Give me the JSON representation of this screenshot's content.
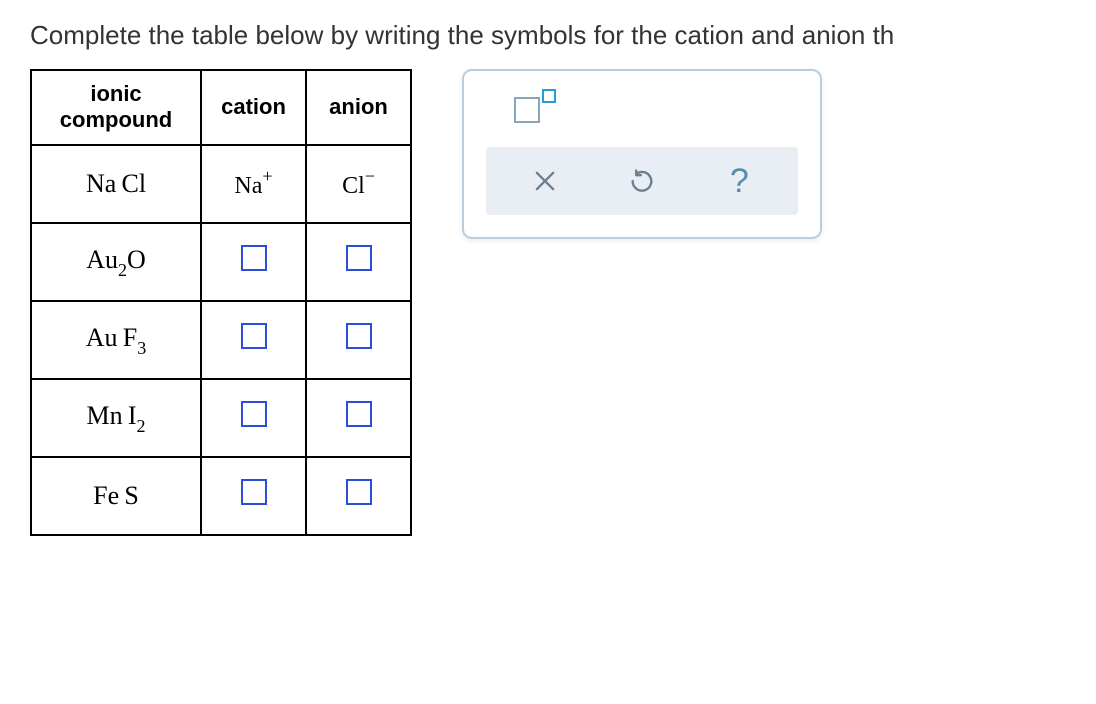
{
  "instruction": "Complete the table below by writing the symbols for the cation and anion th",
  "table": {
    "headers": {
      "compound_line1": "ionic",
      "compound_line2": "compound",
      "cation": "cation",
      "anion": "anion"
    },
    "rows": [
      {
        "compound_base1": "Na",
        "compound_sub1": "",
        "compound_base2": "Cl",
        "compound_sub2": "",
        "cation_base": "Na",
        "cation_sup": "+",
        "anion_base": "Cl",
        "anion_sup": "−",
        "filled": true
      },
      {
        "compound_base1": "Au",
        "compound_sub1": "2",
        "compound_base2": "O",
        "compound_sub2": "",
        "filled": false
      },
      {
        "compound_base1": "Au",
        "compound_sub1": "",
        "compound_base2": "F",
        "compound_sub2": "3",
        "filled": false
      },
      {
        "compound_base1": "Mn",
        "compound_sub1": "",
        "compound_base2": "I",
        "compound_sub2": "2",
        "filled": false
      },
      {
        "compound_base1": "Fe",
        "compound_sub1": "",
        "compound_base2": "S",
        "compound_sub2": "",
        "filled": false
      }
    ]
  },
  "toolbar": {
    "clear": "×",
    "reset": "↺",
    "help": "?"
  }
}
